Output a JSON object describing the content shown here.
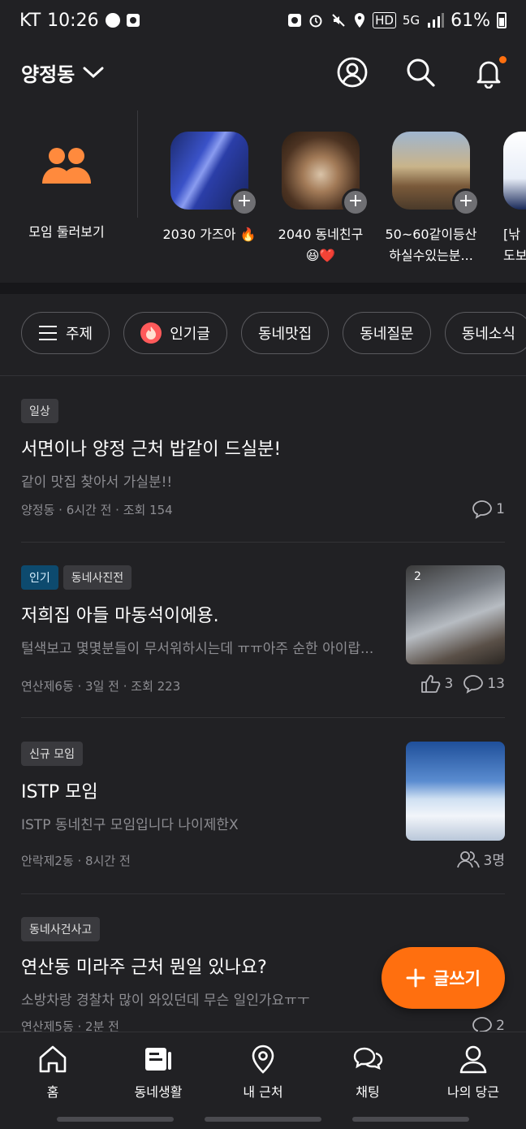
{
  "status_bar": {
    "carrier": "KT",
    "time": "10:26",
    "network": "5G",
    "hd": "HD",
    "battery": "61%"
  },
  "header": {
    "location": "양정동",
    "icons": [
      "profile-icon",
      "search-icon",
      "bell-icon"
    ]
  },
  "groups": {
    "browse_label": "모임 둘러보기",
    "items": [
      {
        "label": "2030 가즈아 🔥"
      },
      {
        "label": "2040 동네친구\n😆❤️"
      },
      {
        "label": "50~60같이등산\n하실수있는분..."
      },
      {
        "label": "[낚\n도보"
      }
    ]
  },
  "chips": [
    {
      "label": "주제",
      "icon": "menu-icon"
    },
    {
      "label": "인기글",
      "icon": "fire-icon"
    },
    {
      "label": "동네맛집"
    },
    {
      "label": "동네질문"
    },
    {
      "label": "동네소식"
    }
  ],
  "posts": [
    {
      "tags": [
        "일상"
      ],
      "title": "서면이나 양정 근처 밥같이 드실분!",
      "body": "같이 맛집 찾아서 가실분!!",
      "meta": "양정동 · 6시간 전 · 조회 154",
      "comments": "1"
    },
    {
      "tags": [
        "인기",
        "동네사진전"
      ],
      "title": "저희집 아들 마동석이에용.",
      "body": "털색보고 몇몇분들이 무서워하시는데 ㅠㅠ아주 순한 아이랍...",
      "meta": "연산제6동 · 3일 전 · 조회 223",
      "likes": "3",
      "comments": "13",
      "image_count": "2"
    },
    {
      "tags": [
        "신규 모임"
      ],
      "title": "ISTP 모임",
      "body": "ISTP 동네친구 모임입니다 나이제한X",
      "meta": "안락제2동 · 8시간 전",
      "members": "3명"
    },
    {
      "tags": [
        "동네사건사고"
      ],
      "title": "연산동 미라주 근처 뭔일 있나요?",
      "body": "소방차랑 경찰차 많이 와있던데 무슨 일인가요ㅠㅜ",
      "meta": "연산제5동 · 2분 전",
      "comments": "2"
    }
  ],
  "fab": {
    "label": "글쓰기"
  },
  "nav": [
    {
      "label": "홈",
      "icon": "home-icon"
    },
    {
      "label": "동네생활",
      "icon": "newspaper-icon"
    },
    {
      "label": "내 근처",
      "icon": "location-pin-icon"
    },
    {
      "label": "채팅",
      "icon": "chat-icon"
    },
    {
      "label": "나의 당근",
      "icon": "person-icon"
    }
  ],
  "colors": {
    "accent": "#ff6f0f",
    "background": "#212124",
    "hot_tag": "#0d4a6e"
  }
}
